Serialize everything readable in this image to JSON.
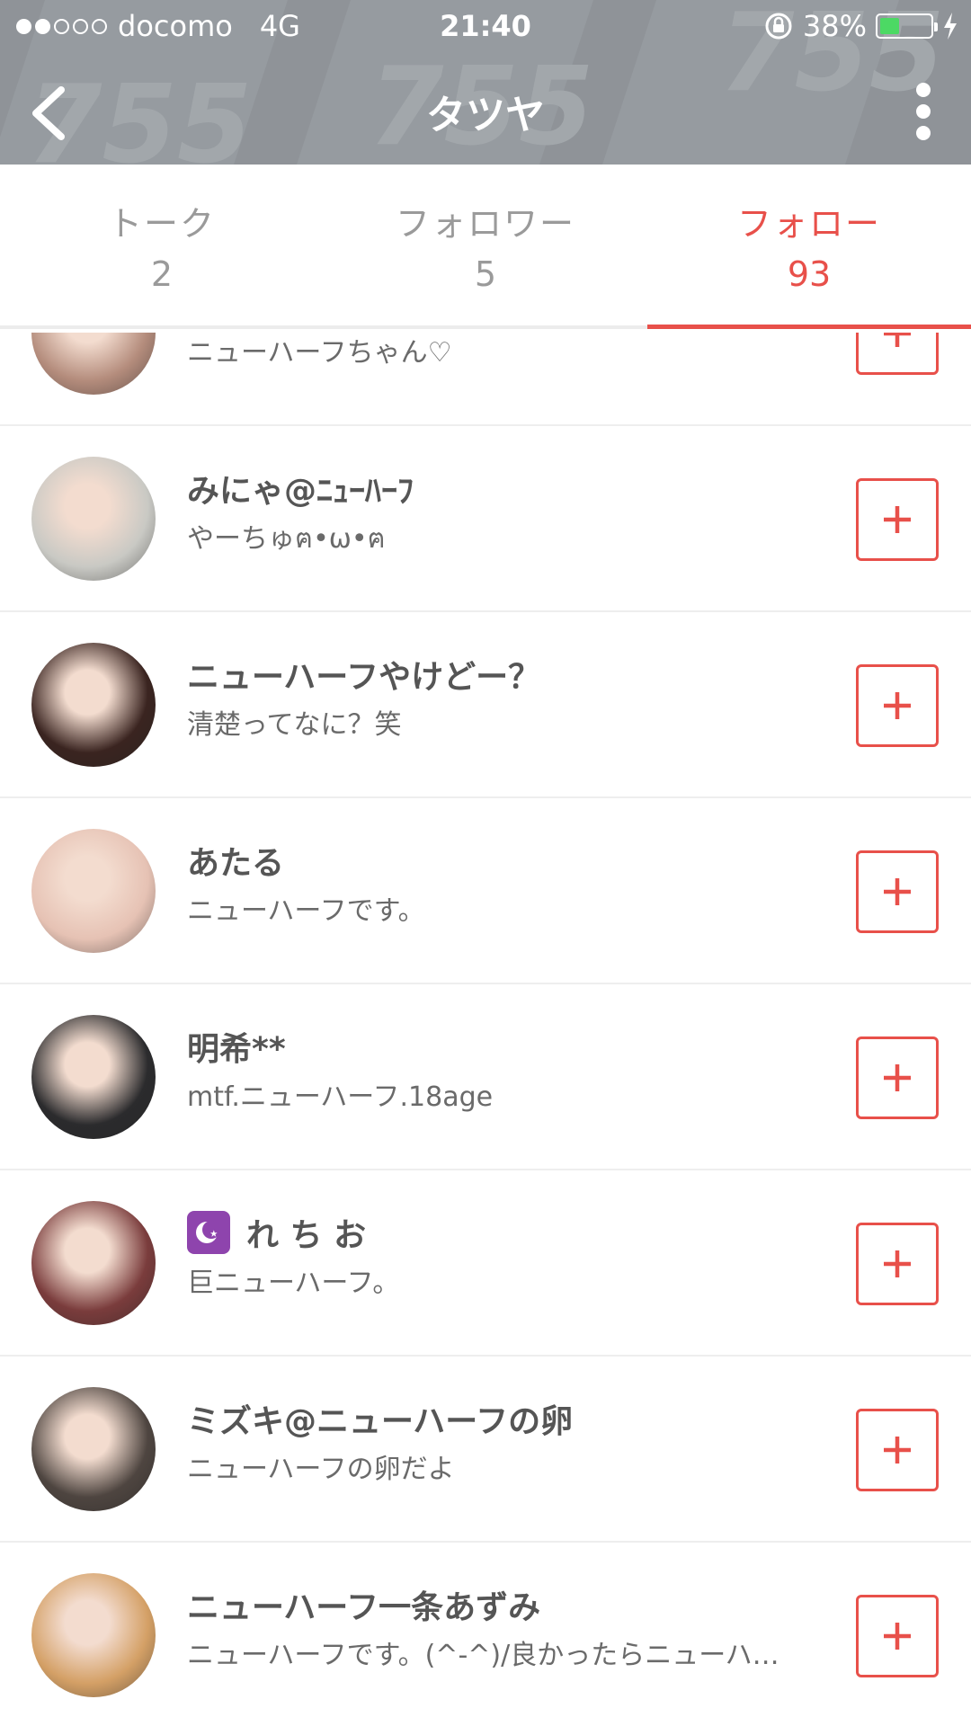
{
  "status_bar": {
    "carrier": "docomo",
    "network": "4G",
    "time": "21:40",
    "battery_percent": "38%",
    "battery_level": 0.38,
    "signal_bars_filled": 2,
    "signal_bars_total": 5
  },
  "nav": {
    "title": "タツヤ"
  },
  "tabs": [
    {
      "label": "トーク",
      "count": "2"
    },
    {
      "label": "フォロワー",
      "count": "5"
    },
    {
      "label": "フォロー",
      "count": "93"
    }
  ],
  "colors": {
    "accent": "#e8504a",
    "header_bg": "#8f9398",
    "battery_green": "#4cd964"
  },
  "users": [
    {
      "name": "",
      "bio": "ニューハーフちゃん♡",
      "avatar_color": "#b48c7c"
    },
    {
      "name": "みにゃ@ﾆｭｰﾊｰﾌ",
      "bio": "やーちゅฅ•ω•ฅ",
      "avatar_color": "#c9c9c4"
    },
    {
      "name": "ニューハーフやけどー？",
      "bio": "清楚ってなに？笑",
      "avatar_color": "#3a2420"
    },
    {
      "name": "あたる",
      "bio": "ニューハーフです。",
      "avatar_color": "#e6c2b4"
    },
    {
      "name": "明希**",
      "bio": "mtf.ニューハーフ.18age",
      "avatar_color": "#2b2b2d"
    },
    {
      "name": "れ ち お",
      "bio": "巨ニューハーフ。",
      "avatar_color": "#7a3c3c",
      "badge": "moon"
    },
    {
      "name": "ミズキ@ニューハーフの卵",
      "bio": "ニューハーフの卵だよ",
      "avatar_color": "#4e4540"
    },
    {
      "name": "ニューハーフ一条あずみ",
      "bio": "ニューハーフです。(^-^)/良かったらニューハ…",
      "avatar_color": "#d4a066"
    }
  ]
}
